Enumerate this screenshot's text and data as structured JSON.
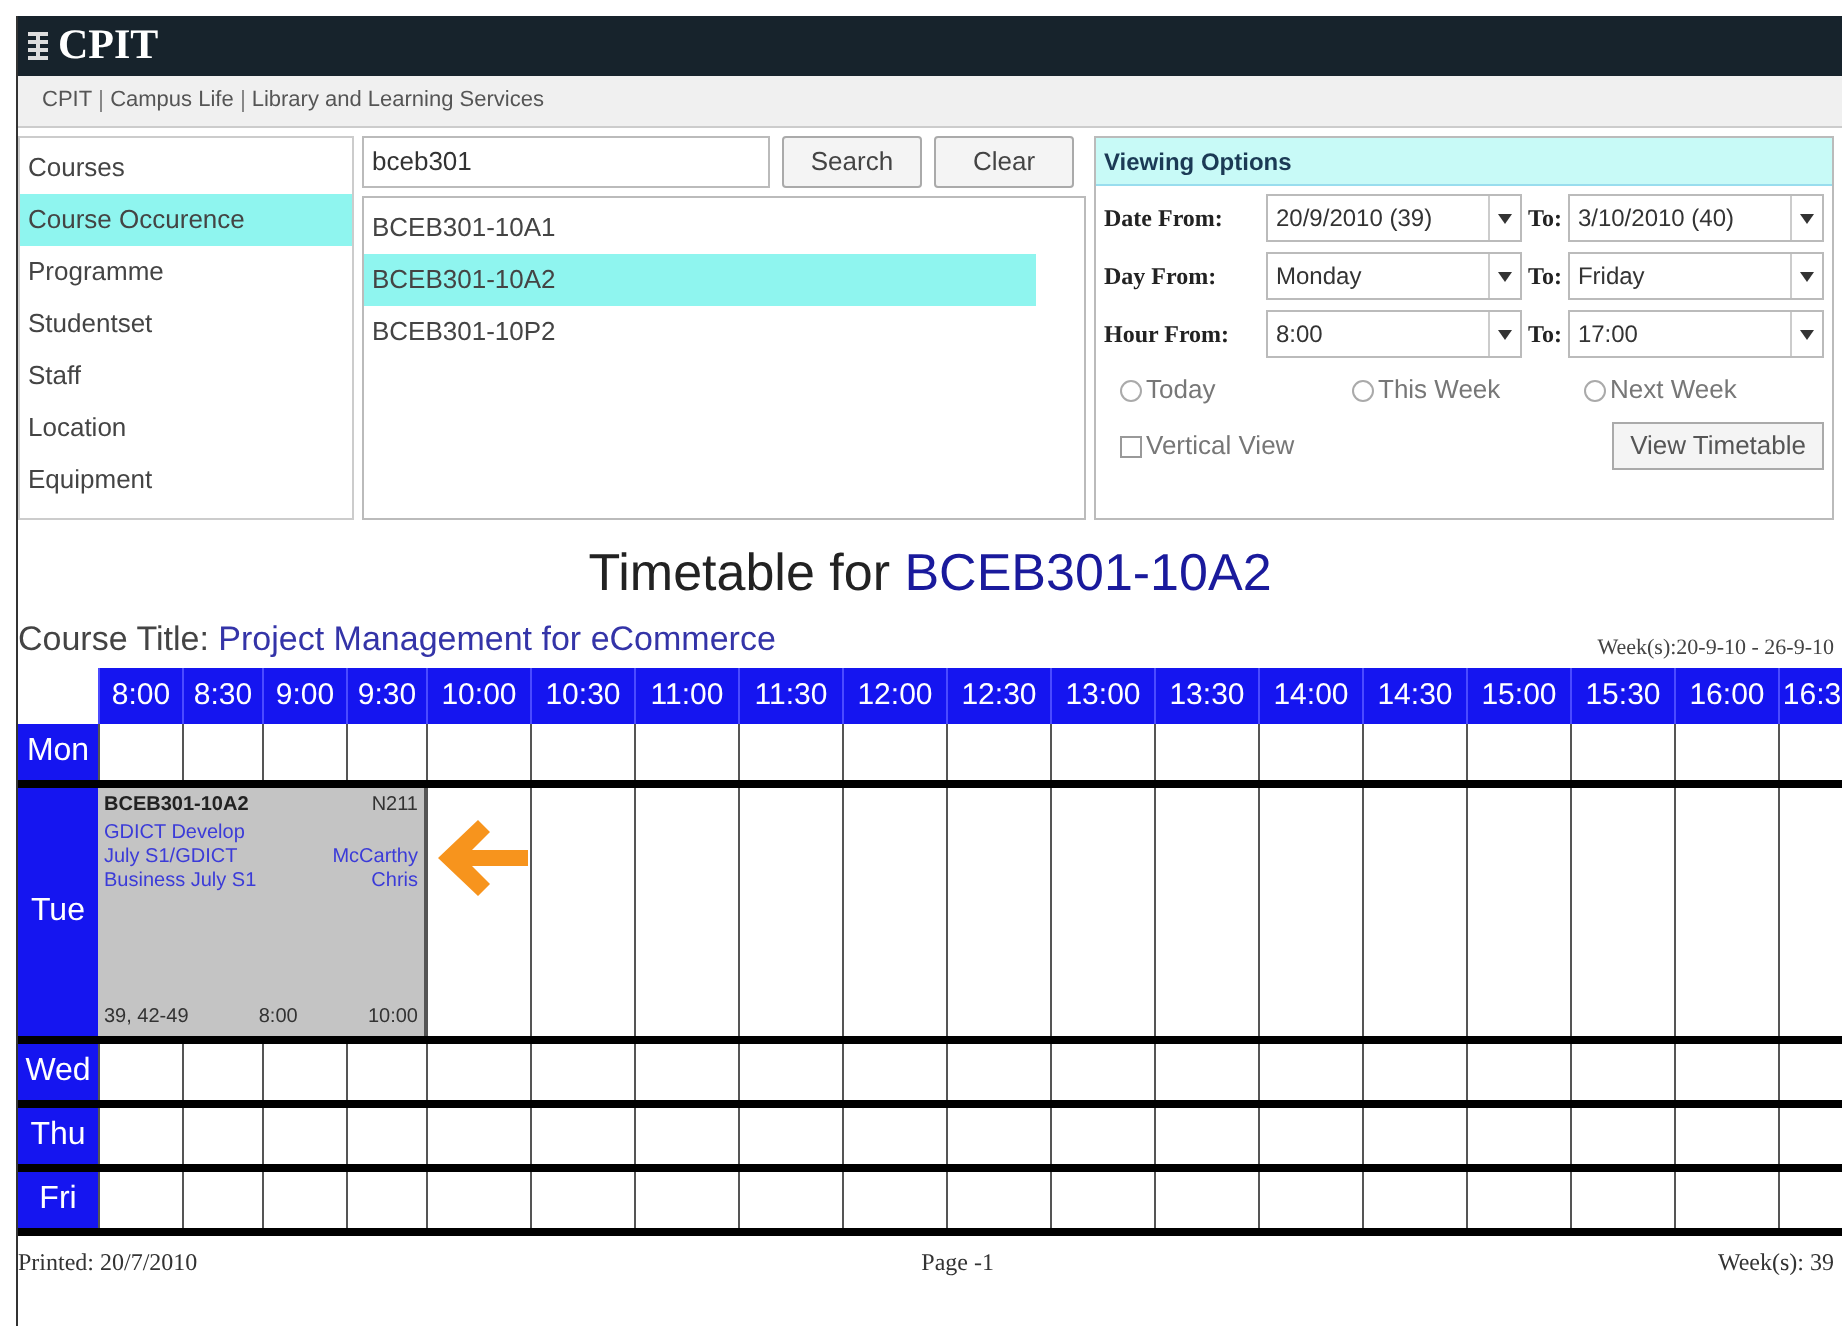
{
  "header": {
    "logo": "CPIT"
  },
  "nav_links": [
    "CPIT",
    "Campus Life",
    "Library and Learning Services"
  ],
  "sidebar": {
    "items": [
      {
        "label": "Courses",
        "selected": false
      },
      {
        "label": "Course Occurence",
        "selected": true
      },
      {
        "label": "Programme",
        "selected": false
      },
      {
        "label": "Studentset",
        "selected": false
      },
      {
        "label": "Staff",
        "selected": false
      },
      {
        "label": "Location",
        "selected": false
      },
      {
        "label": "Equipment",
        "selected": false
      }
    ]
  },
  "search": {
    "value": "bceb301",
    "buttons": [
      "Search",
      "Clear"
    ]
  },
  "results": [
    {
      "label": "BCEB301-10A1",
      "selected": false
    },
    {
      "label": "BCEB301-10A2",
      "selected": true
    },
    {
      "label": "BCEB301-10P2",
      "selected": false
    }
  ],
  "viewing_options": {
    "title": "Viewing Options",
    "ranges": [
      {
        "label": "Date From:",
        "from": "20/9/2010 (39)",
        "to_label": "To:",
        "to": "3/10/2010 (40)"
      },
      {
        "label": "Day From:",
        "from": "Monday",
        "to_label": "To:",
        "to": "Friday"
      },
      {
        "label": "Hour From:",
        "from": "8:00",
        "to_label": "To:",
        "to": "17:00"
      }
    ],
    "radios": [
      {
        "label": "Today",
        "selected": false
      },
      {
        "label": "This Week",
        "selected": false
      },
      {
        "label": "Next Week",
        "selected": false
      }
    ],
    "vertical_view": {
      "label": "Vertical View",
      "checked": false
    },
    "button": "View Timetable"
  },
  "timetable": {
    "title_prefix": "Timetable for",
    "title_code": "BCEB301-10A2",
    "course_label": "Course Title:",
    "course_title": "Project Management for eCommerce",
    "weeks": "Week(s):20-9-10 - 26-9-10",
    "times": [
      "8:00",
      "8:30",
      "9:00",
      "9:30",
      "10:00",
      "10:30",
      "11:00",
      "11:30",
      "12:00",
      "12:30",
      "13:00",
      "13:30",
      "14:00",
      "14:30",
      "15:00",
      "15:30",
      "16:00",
      "16:3"
    ],
    "days": [
      {
        "label": "Mon"
      },
      {
        "label": "Tue",
        "event": {
          "code": "BCEB301-10A2",
          "room": "N211",
          "groups": "GDICT Develop July S1/GDICT Business July S1",
          "staff": "McCarthy Chris",
          "weeks": "39, 42-49",
          "start": "8:00",
          "end": "10:00"
        }
      },
      {
        "label": "Wed"
      },
      {
        "label": "Thu"
      },
      {
        "label": "Fri"
      }
    ]
  },
  "footer": {
    "printed": "Printed: 20/7/2010",
    "page": "Page -1",
    "weeks": "Week(s): 39"
  }
}
